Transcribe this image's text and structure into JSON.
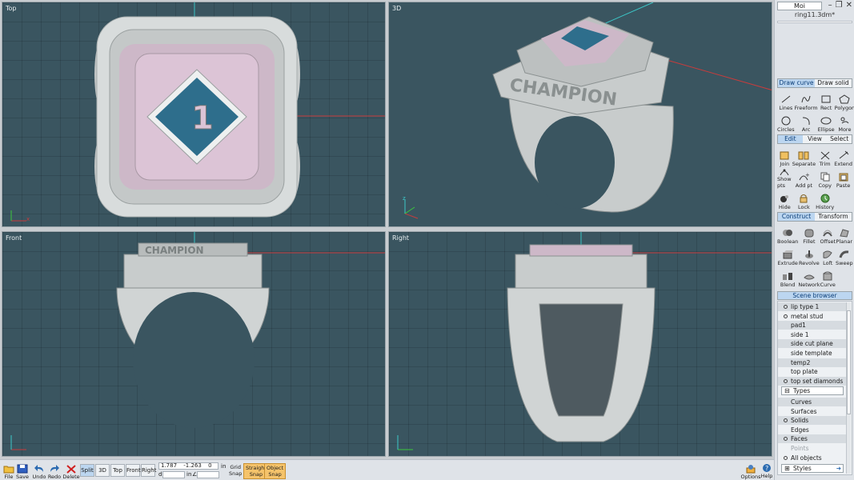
{
  "app": {
    "title": "Moi",
    "file_name": "ring11.3dm*"
  },
  "viewports": {
    "top": "Top",
    "persp": "3D",
    "front": "Front",
    "right": "Right"
  },
  "axes": {
    "x": "x",
    "y": "y",
    "z": "z"
  },
  "panel": {
    "draw_tabs": [
      "Draw curve",
      "Draw solid"
    ],
    "draw_tools": [
      "Lines",
      "Freeform",
      "Rect",
      "Polygon",
      "Circles",
      "Arc",
      "Ellipse",
      "More"
    ],
    "edit_tabs": [
      "Edit",
      "View",
      "Select"
    ],
    "edit_tools": [
      "Join",
      "Separate",
      "Trim",
      "Extend",
      "Show pts",
      "Add pt",
      "Copy",
      "Paste",
      "Hide",
      "Lock",
      "History"
    ],
    "construct_tabs": [
      "Construct",
      "Transform"
    ],
    "construct_tools": [
      "Boolean",
      "Fillet",
      "Offset",
      "Planar",
      "Extrude",
      "Revolve",
      "Loft",
      "Sweep",
      "Blend",
      "Network",
      "Curve"
    ],
    "scene_browser": "Scene browser",
    "scene_items": [
      {
        "label": "lip type 1",
        "bullet": true
      },
      {
        "label": "metal stud",
        "bullet": true
      },
      {
        "label": "pad1",
        "bullet": false
      },
      {
        "label": "side 1",
        "bullet": false
      },
      {
        "label": "side cut plane",
        "bullet": false
      },
      {
        "label": "side template",
        "bullet": false
      },
      {
        "label": "temp2",
        "bullet": false
      },
      {
        "label": "top plate",
        "bullet": false
      },
      {
        "label": "top set diamonds",
        "bullet": true
      }
    ],
    "types_label": "Types",
    "type_items": [
      {
        "label": "Curves",
        "bullet": false,
        "dim": false
      },
      {
        "label": "Surfaces",
        "bullet": false,
        "dim": false
      },
      {
        "label": "Solids",
        "bullet": true,
        "dim": false
      },
      {
        "label": "Edges",
        "bullet": false,
        "dim": false
      },
      {
        "label": "Faces",
        "bullet": true,
        "dim": false
      },
      {
        "label": "Points",
        "bullet": false,
        "dim": true
      }
    ],
    "all_objects": "All objects",
    "styles": "Styles"
  },
  "toolbar": {
    "file": "File",
    "save": "Save",
    "undo": "Undo",
    "redo": "Redo",
    "delete": "Delete",
    "views": [
      "Split",
      "3D",
      "Top",
      "Front",
      "Right"
    ],
    "active_view": "Split",
    "coord_x": "1.787",
    "coord_y": "-1.263",
    "coord_z": "0",
    "unit": "in",
    "dist_label": "d",
    "angle_unit": "in",
    "angle_sym": "∠",
    "grid_snap": [
      "Grid",
      "Snap"
    ],
    "straight_snap": [
      "Straight",
      "Snap"
    ],
    "object_snap": [
      "Object",
      "Snap"
    ],
    "options": "Options",
    "help": "Help"
  },
  "colors": {
    "viewport_bg": "#3a5560",
    "axis_red": "#c83c3c",
    "axis_cyan": "#3cc8c8",
    "panel_active": "#bcd6f0",
    "snap_on": "#f5c36b"
  }
}
